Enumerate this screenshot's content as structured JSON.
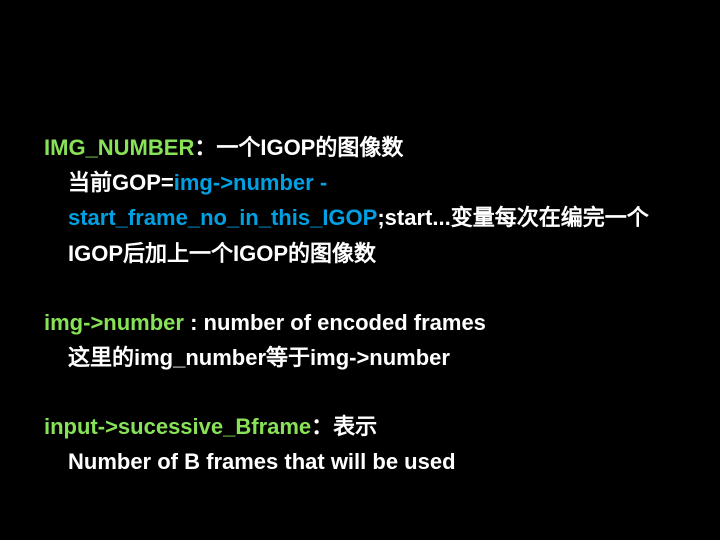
{
  "block1": {
    "term": "IMG_NUMBER",
    "desc1": "：一个IGOP的图像数",
    "desc2_prefix": "当前GOP=",
    "expr_left": "img->number",
    "expr_mid": " - ",
    "expr_right": "start_frame_no_in_this_IGOP",
    "desc3": ";start...变量每次在编完一个",
    "desc4_indent": "IGOP后加上一个IGOP的图像数"
  },
  "block2": {
    "term": "img->number",
    "desc1": " : number of encoded frames",
    "desc2_indent": "这里的img_number等于img->number"
  },
  "block3": {
    "term": "input->sucessive_Bframe",
    "desc": "：表示",
    "desc2_indent": "Number of B frames that will be used"
  }
}
